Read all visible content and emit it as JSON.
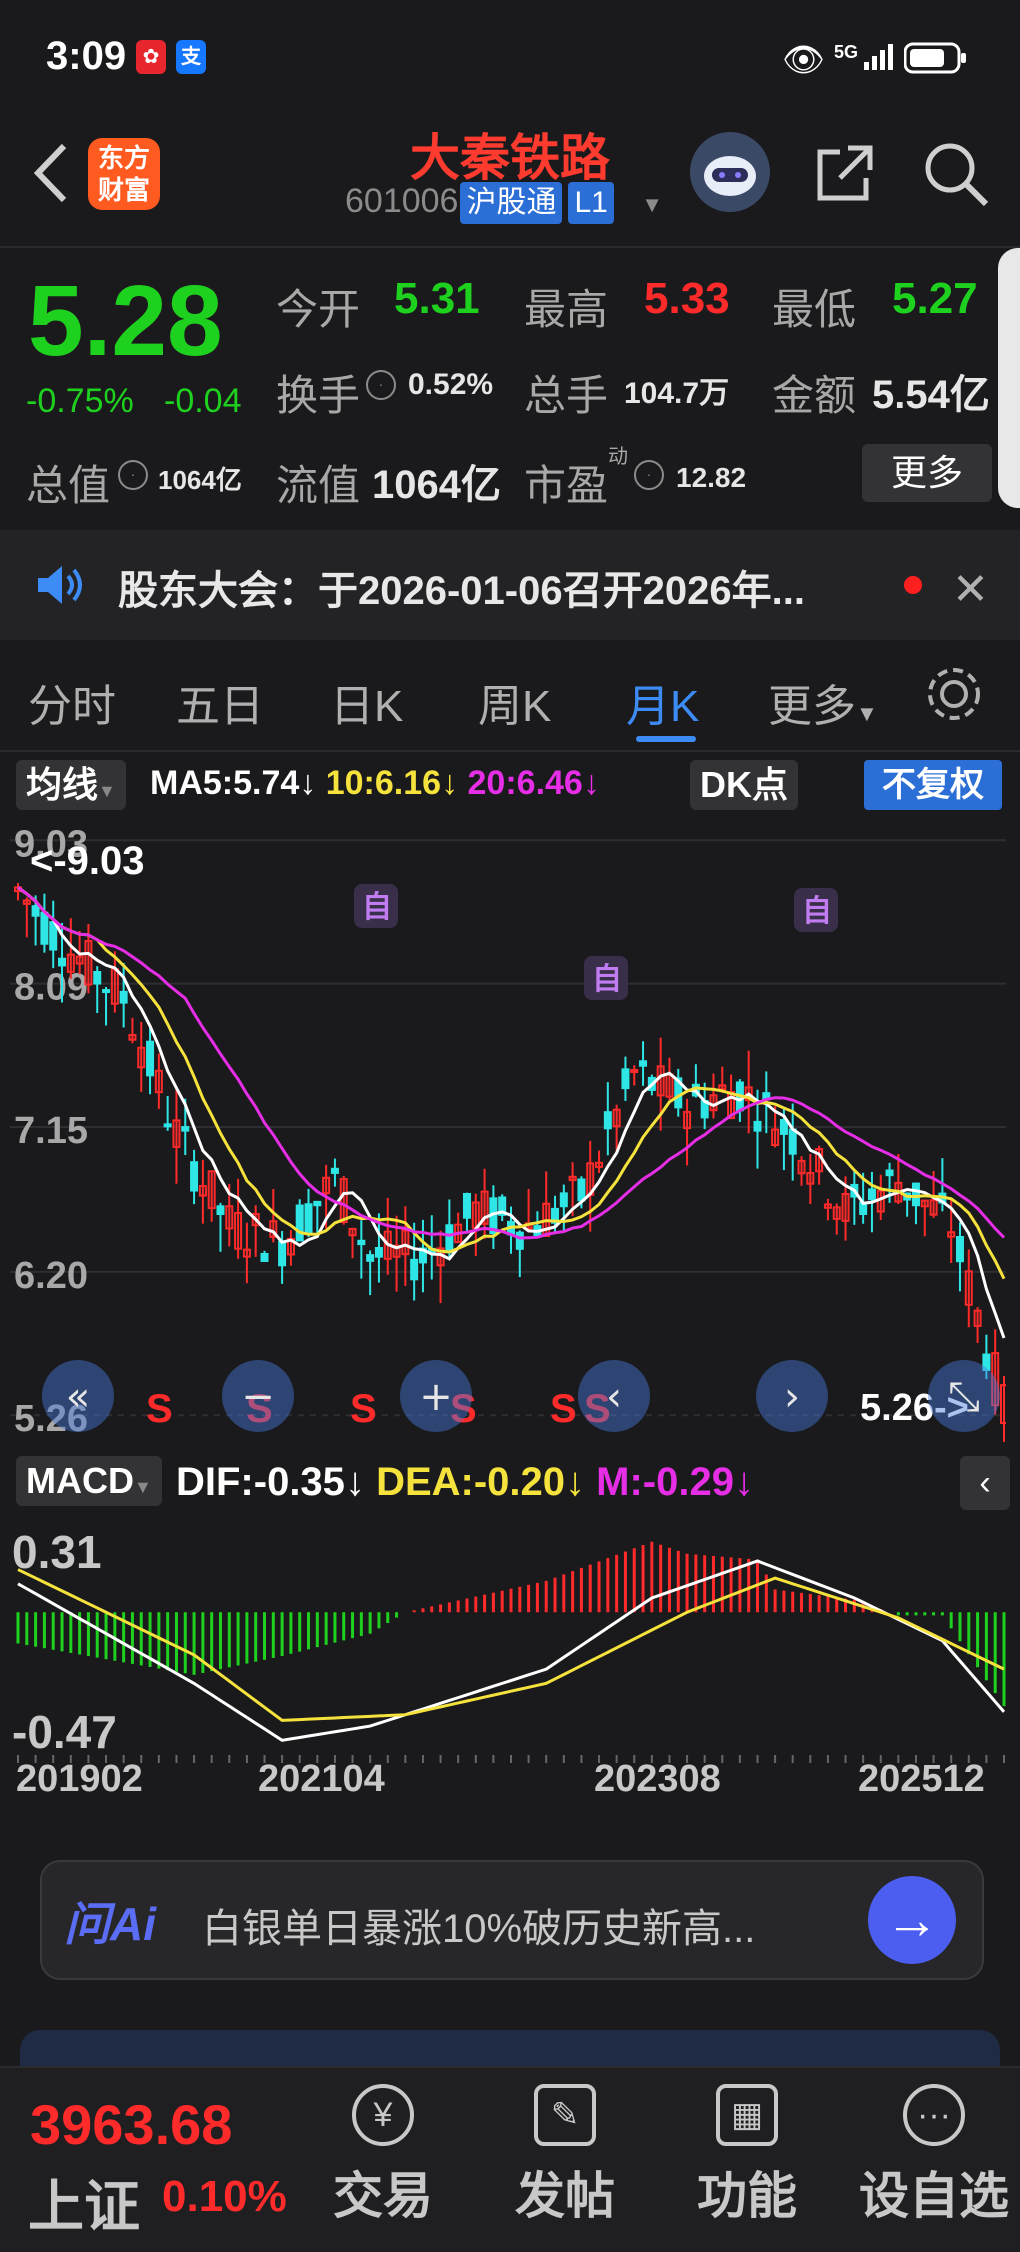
{
  "status_bar": {
    "time": "3:09",
    "network": "5G"
  },
  "header": {
    "title": "大秦铁路",
    "code": "601006",
    "market_tag": "沪股通",
    "level_tag": "L1",
    "logo_line1": "东方",
    "logo_line2": "财富"
  },
  "quote": {
    "price": "5.28",
    "change_pct": "-0.75%",
    "change": "-0.04",
    "open_label": "今开",
    "open": "5.31",
    "high_label": "最高",
    "high": "5.33",
    "low_label": "最低",
    "low": "5.27",
    "turnover_label": "换手",
    "turnover": "0.52%",
    "volume_label": "总手",
    "volume": "104.7万",
    "amount_label": "金额",
    "amount": "5.54亿",
    "mktcap_label": "总值",
    "mktcap": "1064亿",
    "float_label": "流值",
    "float": "1064亿",
    "pe_label": "市盈",
    "pe_sup": "动",
    "pe": "12.82",
    "more_button": "更多"
  },
  "notice": {
    "text": "股东大会：于2026-01-06召开2026年..."
  },
  "tabs": [
    {
      "label": "分时"
    },
    {
      "label": "五日"
    },
    {
      "label": "日K"
    },
    {
      "label": "周K"
    },
    {
      "label": "月K"
    },
    {
      "label": "更多"
    }
  ],
  "indicator": {
    "ma_selector": "均线",
    "ma5": "MA5:5.74",
    "ma10": "10:6.16",
    "ma20": "20:6.46",
    "dk_button": "DK点",
    "fuquan_button": "不复权"
  },
  "kline": {
    "y_labels": [
      "9.03",
      "8.09",
      "7.15",
      "6.20",
      "5.26"
    ],
    "high_marker": "<-9.03",
    "last_marker": "5.26->",
    "zi_marker": "自",
    "s_marker": "S"
  },
  "macd": {
    "selector": "MACD",
    "dif": "DIF:-0.35",
    "dea": "DEA:-0.20",
    "m": "M:-0.29",
    "y_top": "0.31",
    "y_bottom": "-0.47"
  },
  "x_axis": [
    "201902",
    "202104",
    "202308",
    "202512"
  ],
  "ai_bar": {
    "brand": "问Ai",
    "text": "白银单日暴涨10%破历史新高..."
  },
  "bottom_nav": {
    "index_value": "3963.68",
    "index_name": "上证",
    "index_change": "0.10%",
    "items": [
      {
        "label": "交易"
      },
      {
        "label": "发帖"
      },
      {
        "label": "功能"
      },
      {
        "label": "设自选"
      }
    ]
  },
  "colors": {
    "up": "#ff2a2a",
    "down": "#1fd11f",
    "candle_down": "#2ee6e6",
    "ma5": "#ffffff",
    "ma10": "#f5e23c",
    "ma20": "#e52ee5",
    "accent": "#3d8bf5"
  }
}
